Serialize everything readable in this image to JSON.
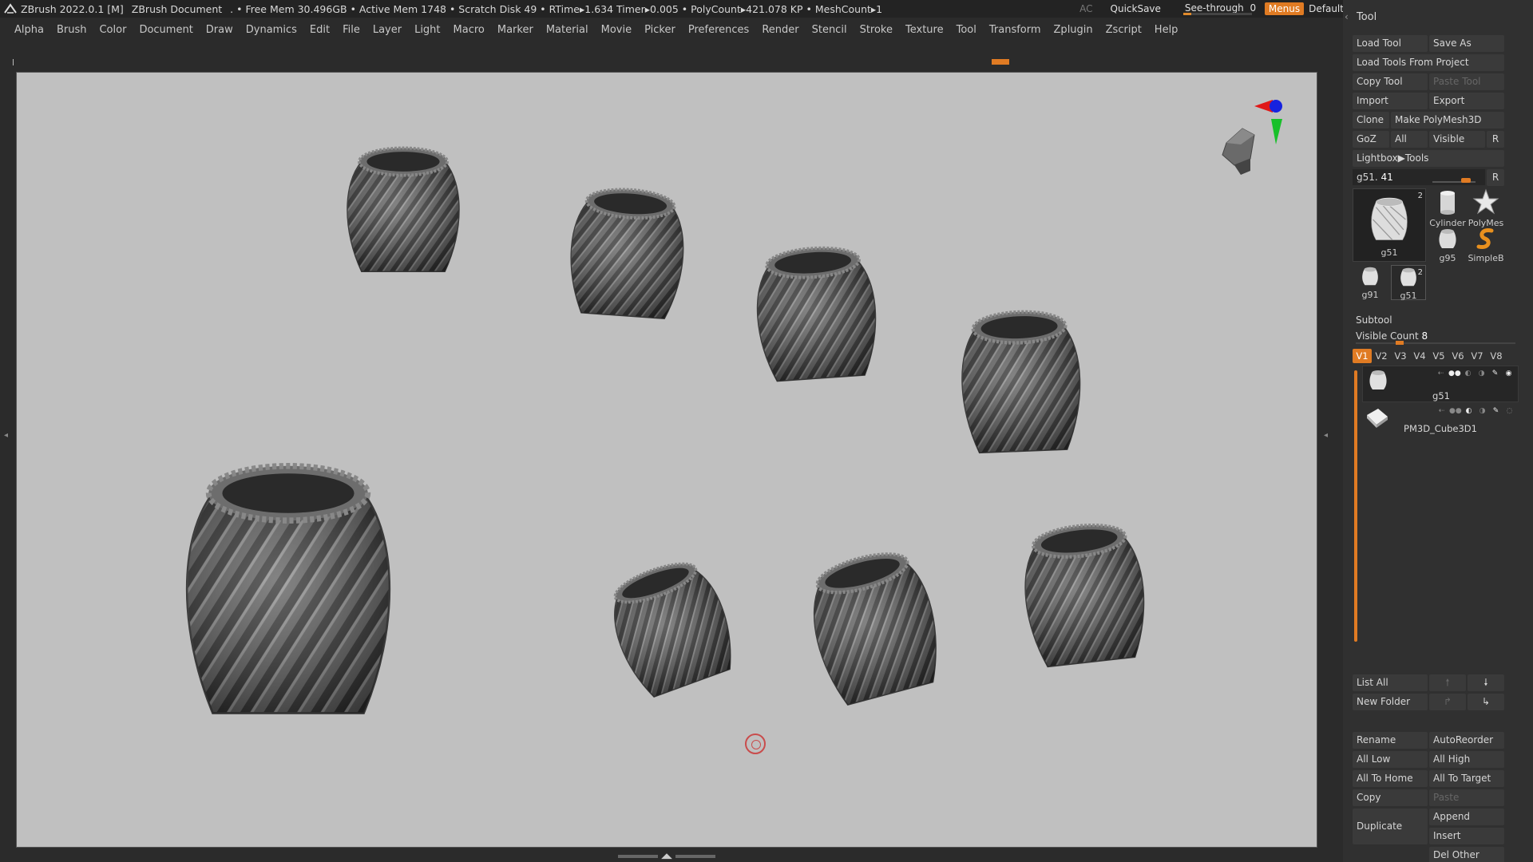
{
  "titlebar": {
    "app": "ZBrush 2022.0.1 [M]",
    "document": "ZBrush Document",
    "stats": ". • Free Mem 30.496GB • Active Mem 1748 • Scratch Disk 49 •  RTime▸1.634 Timer▸0.005 • PolyCount▸421.078 KP  • MeshCount▸1",
    "ac": "AC",
    "quicksave": "QuickSave",
    "seethrough_label": "See-through",
    "seethrough_value": "0",
    "menus": "Menus",
    "default_zscript": "DefaultZScript",
    "accent": "#e07b23"
  },
  "menubar": [
    "Alpha",
    "Brush",
    "Color",
    "Document",
    "Draw",
    "Dynamics",
    "Edit",
    "File",
    "Layer",
    "Light",
    "Macro",
    "Marker",
    "Material",
    "Movie",
    "Picker",
    "Preferences",
    "Render",
    "Stencil",
    "Stroke",
    "Texture",
    "Tool",
    "Transform",
    "Zplugin",
    "Zscript",
    "Help"
  ],
  "tool_panel": {
    "title": "Tool",
    "load_tool": "Load Tool",
    "save_as": "Save As",
    "load_from_project": "Load Tools From Project",
    "copy_tool": "Copy Tool",
    "paste_tool": "Paste Tool",
    "import": "Import",
    "export": "Export",
    "clone": "Clone",
    "make_polymesh": "Make PolyMesh3D",
    "goz": "GoZ",
    "all": "All",
    "visible": "Visible",
    "r": "R",
    "lightbox": "Lightbox▶Tools",
    "slider_label": "g51.",
    "slider_value": "41",
    "thumbs": [
      {
        "name": "g51",
        "count": "2"
      },
      {
        "name": "Cylinder",
        "count": ""
      },
      {
        "name": "PolyMes",
        "count": ""
      },
      {
        "name": "g95",
        "count": ""
      },
      {
        "name": "SimpleB",
        "count": ""
      },
      {
        "name": "g91",
        "count": ""
      },
      {
        "name": "g51",
        "count": "2"
      }
    ]
  },
  "subtool": {
    "title": "Subtool",
    "visible_count_label": "Visible Count",
    "visible_count": "8",
    "tabs": [
      "V1",
      "V2",
      "V3",
      "V4",
      "V5",
      "V6",
      "V7",
      "V8"
    ],
    "active_tab": "V1",
    "items": [
      {
        "name": "g51",
        "selected": true
      },
      {
        "name": "PM3D_Cube3D1",
        "selected": false
      }
    ],
    "list_all": "List All",
    "new_folder": "New Folder",
    "rename": "Rename",
    "autoreorder": "AutoReorder",
    "all_low": "All Low",
    "all_high": "All High",
    "all_to_home": "All To Home",
    "all_to_target": "All To Target",
    "copy": "Copy",
    "paste": "Paste",
    "duplicate": "Duplicate",
    "append": "Append",
    "insert": "Insert",
    "del_other": "Del Other"
  }
}
